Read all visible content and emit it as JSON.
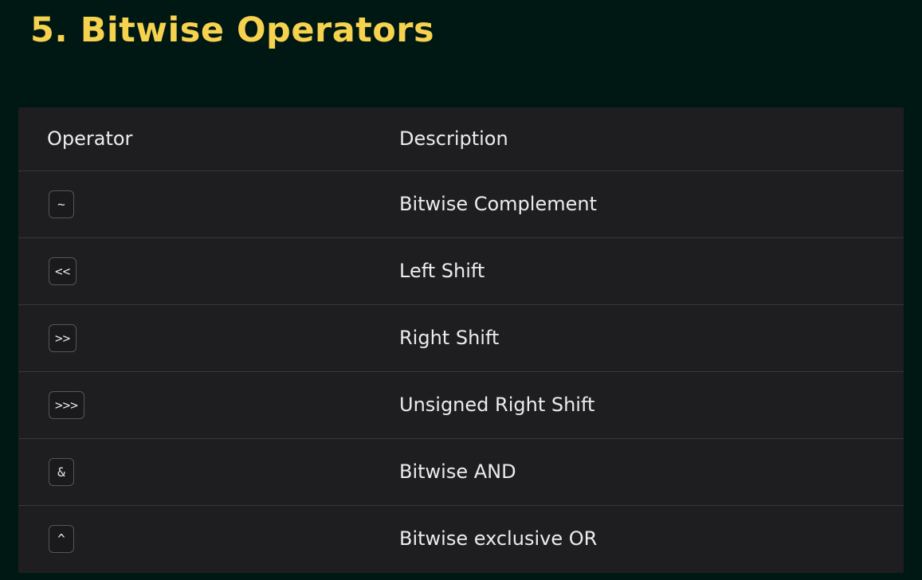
{
  "title": "5. Bitwise Operators",
  "table": {
    "headers": {
      "operator": "Operator",
      "description": "Description"
    },
    "rows": [
      {
        "operator": "~",
        "description": "Bitwise Complement"
      },
      {
        "operator": "<<",
        "description": "Left Shift"
      },
      {
        "operator": ">>",
        "description": "Right Shift"
      },
      {
        "operator": ">>>",
        "description": "Unsigned Right Shift"
      },
      {
        "operator": "&",
        "description": "Bitwise AND"
      },
      {
        "operator": "^",
        "description": "Bitwise exclusive OR"
      }
    ]
  },
  "colors": {
    "background": "#001813",
    "title": "#f6d24e",
    "panel": "#1e1e20",
    "divider": "#37373b",
    "text": "#ececec"
  }
}
